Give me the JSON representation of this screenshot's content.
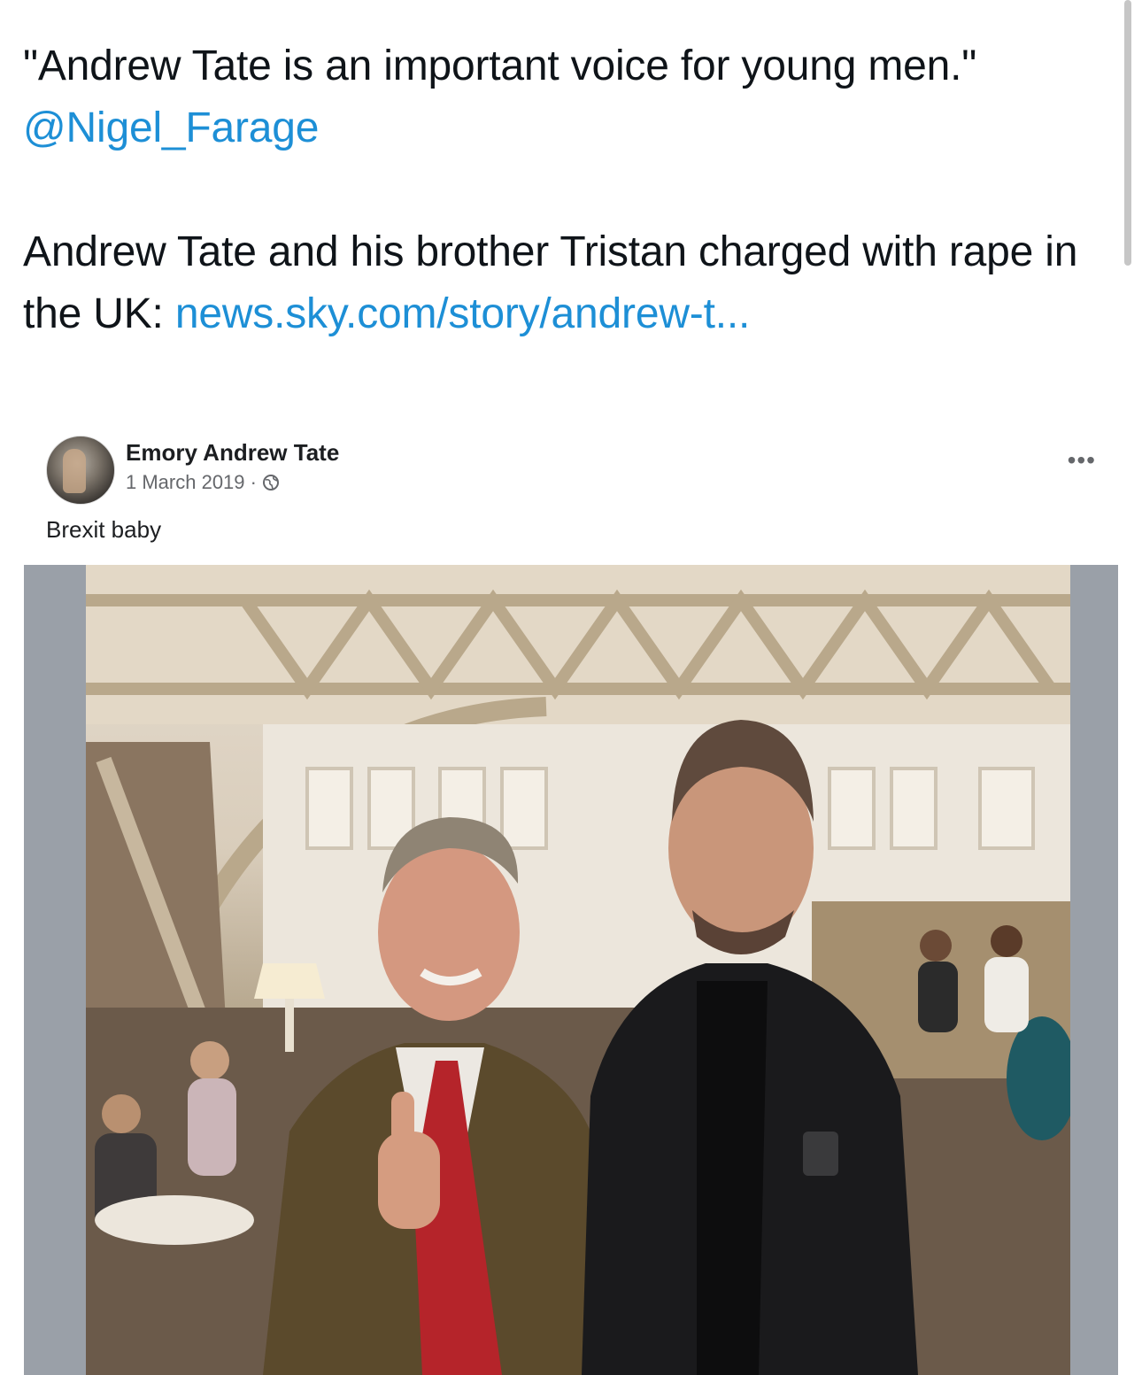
{
  "tweet": {
    "quote": "\"Andrew Tate is an important voice for young men.\"",
    "mention": "@Nigel_Farage",
    "text": "Andrew Tate and his brother Tristan charged with rape in the UK: ",
    "link": "news.sky.com/story/andrew-t..."
  },
  "embedded_post": {
    "author": "Emory Andrew Tate",
    "date": "1 March 2019 ·",
    "caption": "Brexit baby",
    "more_icon": "more-options-icon",
    "privacy_icon": "globe-icon"
  },
  "colors": {
    "link": "#1d8fd6",
    "text": "#0f1419",
    "photo_frame": "#9aa0a8"
  }
}
